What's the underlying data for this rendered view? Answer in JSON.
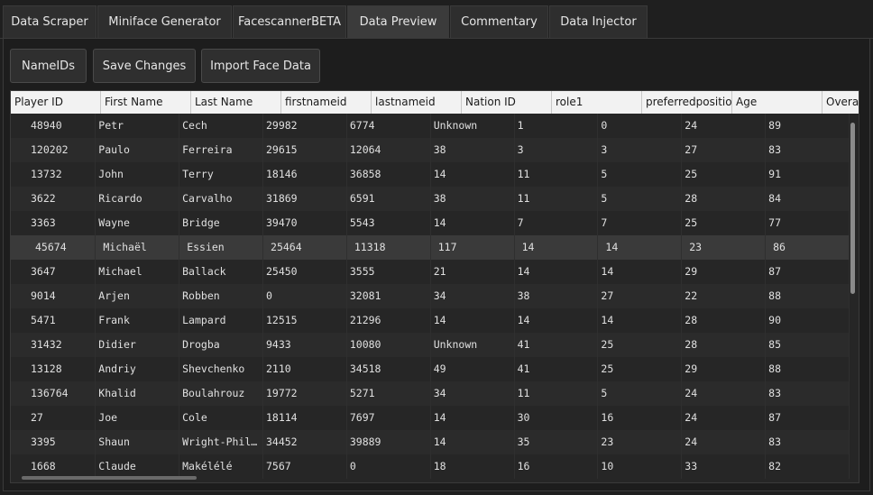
{
  "tabs": [
    {
      "label": "Data Scraper",
      "active": false
    },
    {
      "label": "Miniface Generator",
      "active": false
    },
    {
      "label": "FacescannerBETA",
      "active": false
    },
    {
      "label": "Data Preview",
      "active": true
    },
    {
      "label": "Commentary",
      "active": false
    },
    {
      "label": "Data Injector",
      "active": false
    }
  ],
  "toolbar": {
    "nameids_label": "NameIDs",
    "save_label": "Save Changes",
    "import_label": "Import Face Data"
  },
  "table": {
    "columns": [
      "Player ID",
      "First Name",
      "Last Name",
      "firstnameid",
      "lastnameid",
      "Nation ID",
      "role1",
      "preferredposition",
      "Age",
      "Overall"
    ],
    "selected_row": 5,
    "rows": [
      [
        "48940",
        "Petr",
        "Cech",
        "29982",
        "6774",
        "Unknown",
        "1",
        "0",
        "24",
        "89"
      ],
      [
        "120202",
        "Paulo",
        "Ferreira",
        "29615",
        "12064",
        "38",
        "3",
        "3",
        "27",
        "83"
      ],
      [
        "13732",
        "John",
        "Terry",
        "18146",
        "36858",
        "14",
        "11",
        "5",
        "25",
        "91"
      ],
      [
        "3622",
        "Ricardo",
        "Carvalho",
        "31869",
        "6591",
        "38",
        "11",
        "5",
        "28",
        "84"
      ],
      [
        "3363",
        "Wayne",
        "Bridge",
        "39470",
        "5543",
        "14",
        "7",
        "7",
        "25",
        "77"
      ],
      [
        "45674",
        "Michaël",
        "Essien",
        "25464",
        "11318",
        "117",
        "14",
        "14",
        "23",
        "86"
      ],
      [
        "3647",
        "Michael",
        "Ballack",
        "25450",
        "3555",
        "21",
        "14",
        "14",
        "29",
        "87"
      ],
      [
        "9014",
        "Arjen",
        "Robben",
        "0",
        "32081",
        "34",
        "38",
        "27",
        "22",
        "88"
      ],
      [
        "5471",
        "Frank",
        "Lampard",
        "12515",
        "21296",
        "14",
        "14",
        "14",
        "28",
        "90"
      ],
      [
        "31432",
        "Didier",
        "Drogba",
        "9433",
        "10080",
        "Unknown",
        "41",
        "25",
        "28",
        "85"
      ],
      [
        "13128",
        "Andriy",
        "Shevchenko",
        "2110",
        "34518",
        "49",
        "41",
        "25",
        "29",
        "88"
      ],
      [
        "136764",
        "Khalid",
        "Boulahrouz",
        "19772",
        "5271",
        "34",
        "11",
        "5",
        "24",
        "83"
      ],
      [
        "27",
        "Joe",
        "Cole",
        "18114",
        "7697",
        "14",
        "30",
        "16",
        "24",
        "87"
      ],
      [
        "3395",
        "Shaun",
        "Wright-Phillips",
        "34452",
        "39889",
        "14",
        "35",
        "23",
        "24",
        "83"
      ],
      [
        "1668",
        "Claude",
        "Makélélé",
        "7567",
        "0",
        "18",
        "16",
        "10",
        "33",
        "82"
      ]
    ]
  }
}
